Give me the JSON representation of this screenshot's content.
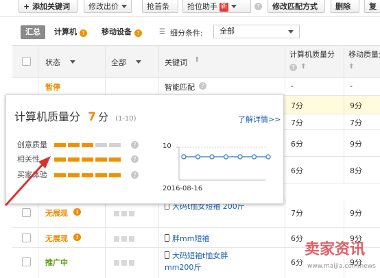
{
  "toolbar": {
    "add_keyword": "+ 添加关键词",
    "modify_bid": "修改出价",
    "grab_top": "抢首条",
    "grab_helper": "抢位助手",
    "new_badge": "新",
    "modify_match": "修改匹配方式",
    "delete": "删除",
    "copy": "复"
  },
  "filter": {
    "tab_summary": "汇总",
    "tab_computer": "计算机",
    "tab_mobile": "移动设备",
    "condition_label": "细分条件:",
    "condition_value": "全部"
  },
  "table": {
    "headers": {
      "status": "状态",
      "all": "全部",
      "keyword": "关键词",
      "pc_quality": "计算机质量分",
      "mobile_quality": "移动质量分"
    },
    "rows": [
      {
        "status": "暂停",
        "keyword": "智能匹配",
        "pc": "-",
        "mobile": "-"
      },
      {
        "pc": "7分",
        "mobile": "9分"
      },
      {
        "pc": "7分",
        "mobile": "7分"
      },
      {
        "pc": "6分",
        "mobile": "9分"
      },
      {
        "pc": "6分",
        "mobile": "8分"
      },
      {
        "status": "无展现",
        "keyword": "大码t恤女短袖 200斤",
        "pc": "7分",
        "mobile": "9分"
      },
      {
        "status": "无展现",
        "keyword": "胖mm短袖",
        "pc": "6分",
        "mobile": "9分"
      },
      {
        "status": "推广中",
        "keyword": "大码短袖t恤女胖mm200斤",
        "pc": "6分",
        "mobile": "9分"
      }
    ]
  },
  "popup": {
    "title": "计算机质量分",
    "score": "7",
    "unit": "分",
    "range": "(1-10)",
    "learn_more": "了解详情>>",
    "metrics": [
      {
        "label": "创意质量",
        "level": 3,
        "max": 5
      },
      {
        "label": "相关性",
        "level": 5,
        "max": 5
      },
      {
        "label": "买家体验",
        "level": 5,
        "max": 5
      }
    ],
    "chart": {
      "y_label": "10",
      "x_label": "2016-08-16",
      "points": 7
    }
  },
  "watermark": {
    "brand": "卖家资讯",
    "url": "www.maijia.com/news"
  },
  "colors": {
    "orange": "#f08a00",
    "green": "#5a9b10",
    "link": "#1a5fb4",
    "highlight": "#fffbdc",
    "red_arrow": "#e0302d"
  }
}
